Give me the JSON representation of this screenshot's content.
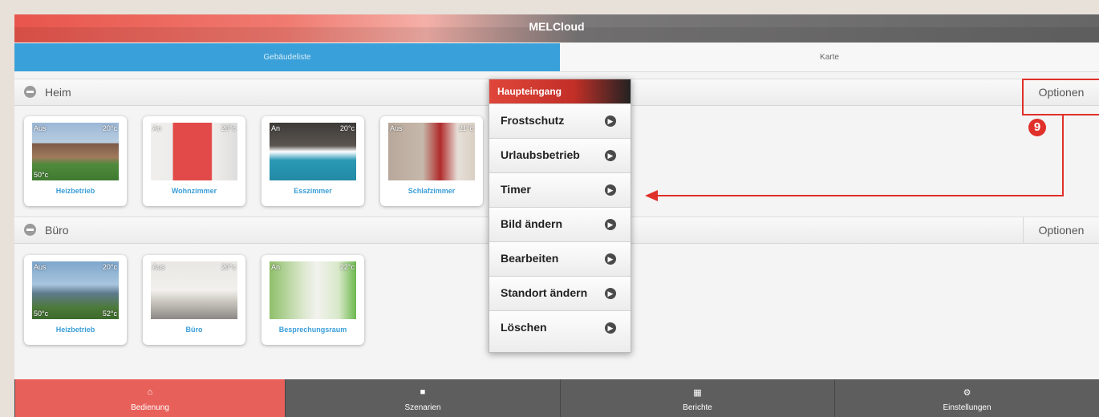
{
  "app_title": "MELCloud",
  "tabs": [
    {
      "label": "Gebäudeliste"
    },
    {
      "label": "Karte"
    }
  ],
  "groups": [
    {
      "name": "Heim",
      "options_label": "Optionen",
      "rooms": [
        {
          "name": "Heizbetrieb",
          "mode": "Aus",
          "temp": "20°c",
          "setpoint": "50°c",
          "image": "house-photo"
        },
        {
          "name": "Wohnzimmer",
          "mode": "An",
          "temp": "20°c",
          "image": "living-room-photo"
        },
        {
          "name": "Esszimmer",
          "mode": "An",
          "temp": "20°c",
          "image": "dining-room-photo"
        },
        {
          "name": "Schlafzimmer",
          "mode": "Aus",
          "temp": "21°c",
          "image": "bedroom-photo"
        }
      ]
    },
    {
      "name": "Büro",
      "options_label": "Optionen",
      "rooms": [
        {
          "name": "Heizbetrieb",
          "mode": "Aus",
          "temp": "20°c",
          "setpoint": "50°c",
          "temp2": "52°c",
          "image": "office-building-photo"
        },
        {
          "name": "Büro",
          "mode": "Aus",
          "temp": "20°c",
          "image": "office-room-photo"
        },
        {
          "name": "Besprechungsraum",
          "mode": "An",
          "temp": "22°c",
          "image": "meeting-room-photo"
        }
      ]
    }
  ],
  "context_menu": {
    "title": "Haupteingang",
    "items": [
      {
        "label": "Frostschutz"
      },
      {
        "label": "Urlaubsbetrieb"
      },
      {
        "label": "Timer"
      },
      {
        "label": "Bild ändern"
      },
      {
        "label": "Bearbeiten"
      },
      {
        "label": "Standort ändern"
      },
      {
        "label": "Löschen"
      }
    ]
  },
  "annotation": {
    "number": "9",
    "color": "#e0302a"
  },
  "bottom_nav": [
    {
      "label": "Bedienung",
      "icon": "home-icon",
      "active": true
    },
    {
      "label": "Szenarien",
      "icon": "camera-icon",
      "active": false
    },
    {
      "label": "Berichte",
      "icon": "grid-icon",
      "active": false
    },
    {
      "label": "Einstellungen",
      "icon": "gear-icon",
      "active": false
    }
  ],
  "colors": {
    "accent_red": "#e8605a",
    "tab_blue": "#3aa0d9",
    "link_blue": "#3a9ed8",
    "nav_gray": "#5e5e5e"
  }
}
